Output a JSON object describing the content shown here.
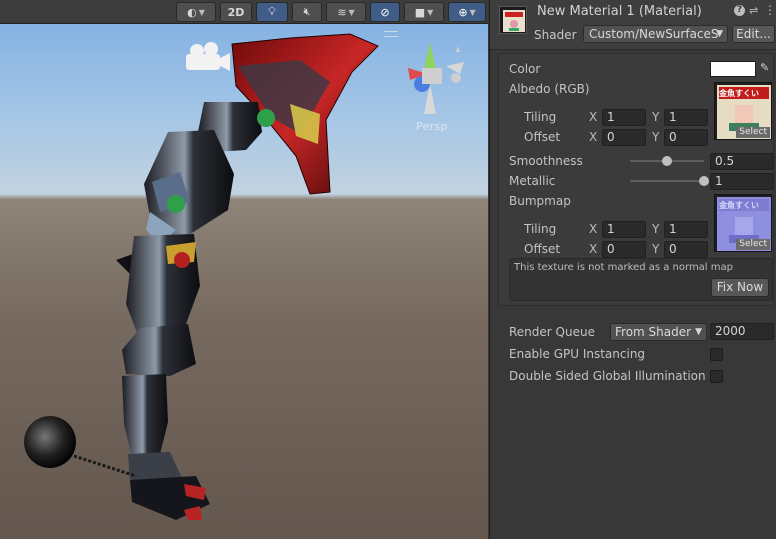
{
  "scene": {
    "toolbar": {
      "draw_mode_icon": "shading-mode-icon",
      "two_d_label": "2D",
      "lighting_icon": "lightbulb-icon",
      "audio_icon": "audio-mute-icon",
      "effects_icon": "effects-layers-icon",
      "hidden_icon": "visibility-off-icon",
      "camera_icon": "camera-icon",
      "gizmos_icon": "gizmo-globe-icon"
    },
    "projection_label": "Persp",
    "colors": {
      "sky": "#a5c6e6",
      "ground": "#6e6259",
      "accent_on": "#3f5d86"
    }
  },
  "inspector": {
    "header": {
      "title": "New Material 1 (Material)",
      "shader_label": "Shader",
      "shader_value": "Custom/NewSurfaceS",
      "edit_label": "Edit..."
    },
    "properties": {
      "color_label": "Color",
      "color_value": "#ffffff",
      "albedo_label": "Albedo (RGB)",
      "albedo_tiling_label": "Tiling",
      "albedo_tiling_x": "1",
      "albedo_tiling_y": "1",
      "albedo_offset_label": "Offset",
      "albedo_offset_x": "0",
      "albedo_offset_y": "0",
      "axis_x": "X",
      "axis_y": "Y",
      "select_label": "Select",
      "albedo_texture_text": "金魚すくい",
      "bumpmap_texture_text": "金魚すくい",
      "smoothness_label": "Smoothness",
      "smoothness_value": "0.5",
      "smoothness_fraction": 0.5,
      "metallic_label": "Metallic",
      "metallic_value": "1",
      "metallic_fraction": 1.0,
      "bumpmap_label": "Bumpmap",
      "bump_tiling_label": "Tiling",
      "bump_tiling_x": "1",
      "bump_tiling_y": "1",
      "bump_offset_label": "Offset",
      "bump_offset_x": "0",
      "bump_offset_y": "0",
      "normal_warning": "This texture is not marked as a normal map",
      "fix_now_label": "Fix Now"
    },
    "advanced": {
      "render_queue_label": "Render Queue",
      "render_queue_mode": "From Shader",
      "render_queue_value": "2000",
      "gpu_instancing_label": "Enable GPU Instancing",
      "gpu_instancing_checked": false,
      "double_sided_gi_label": "Double Sided Global Illumination",
      "double_sided_gi_checked": false
    }
  }
}
